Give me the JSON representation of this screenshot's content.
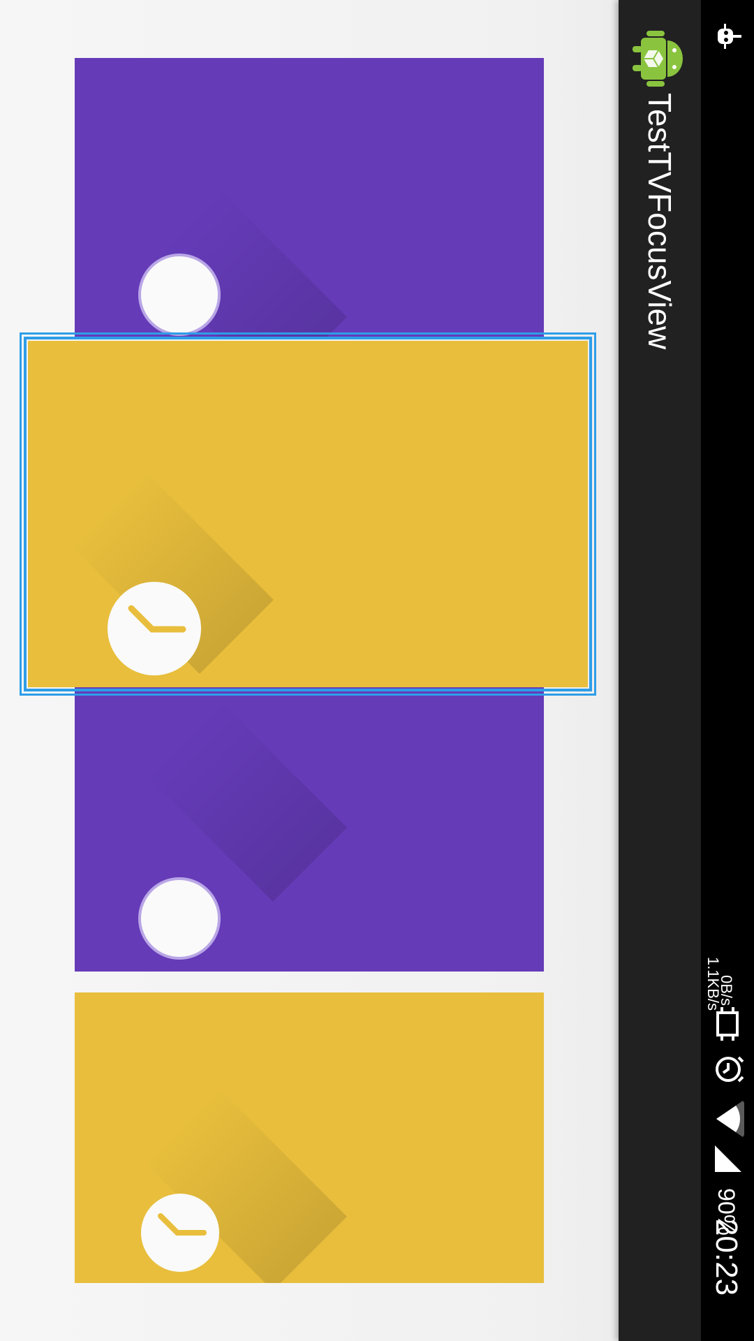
{
  "app": {
    "title": "TestTVFocusView",
    "icon": "android-robot-icon"
  },
  "status_bar": {
    "time": "20:23",
    "battery": "90%",
    "net_up": "0B/s",
    "net_down": "1.1KB/s",
    "icons": [
      "debug-icon",
      "vibrate-icon",
      "alarm-icon",
      "wifi-icon",
      "signal-icon"
    ]
  },
  "cards": [
    {
      "color": "purple",
      "fab": "empty-circle",
      "focused": false
    },
    {
      "color": "yellow",
      "fab": "clock-icon",
      "focused": true
    },
    {
      "color": "purple",
      "fab": "empty-circle",
      "focused": false
    },
    {
      "color": "yellow",
      "fab": "clock-icon",
      "focused": false
    }
  ],
  "colors": {
    "purple": "#653bb8",
    "yellow": "#e8be3c",
    "focus": "#2e9de8",
    "action_bar": "#212121",
    "status_bar": "#000000"
  }
}
